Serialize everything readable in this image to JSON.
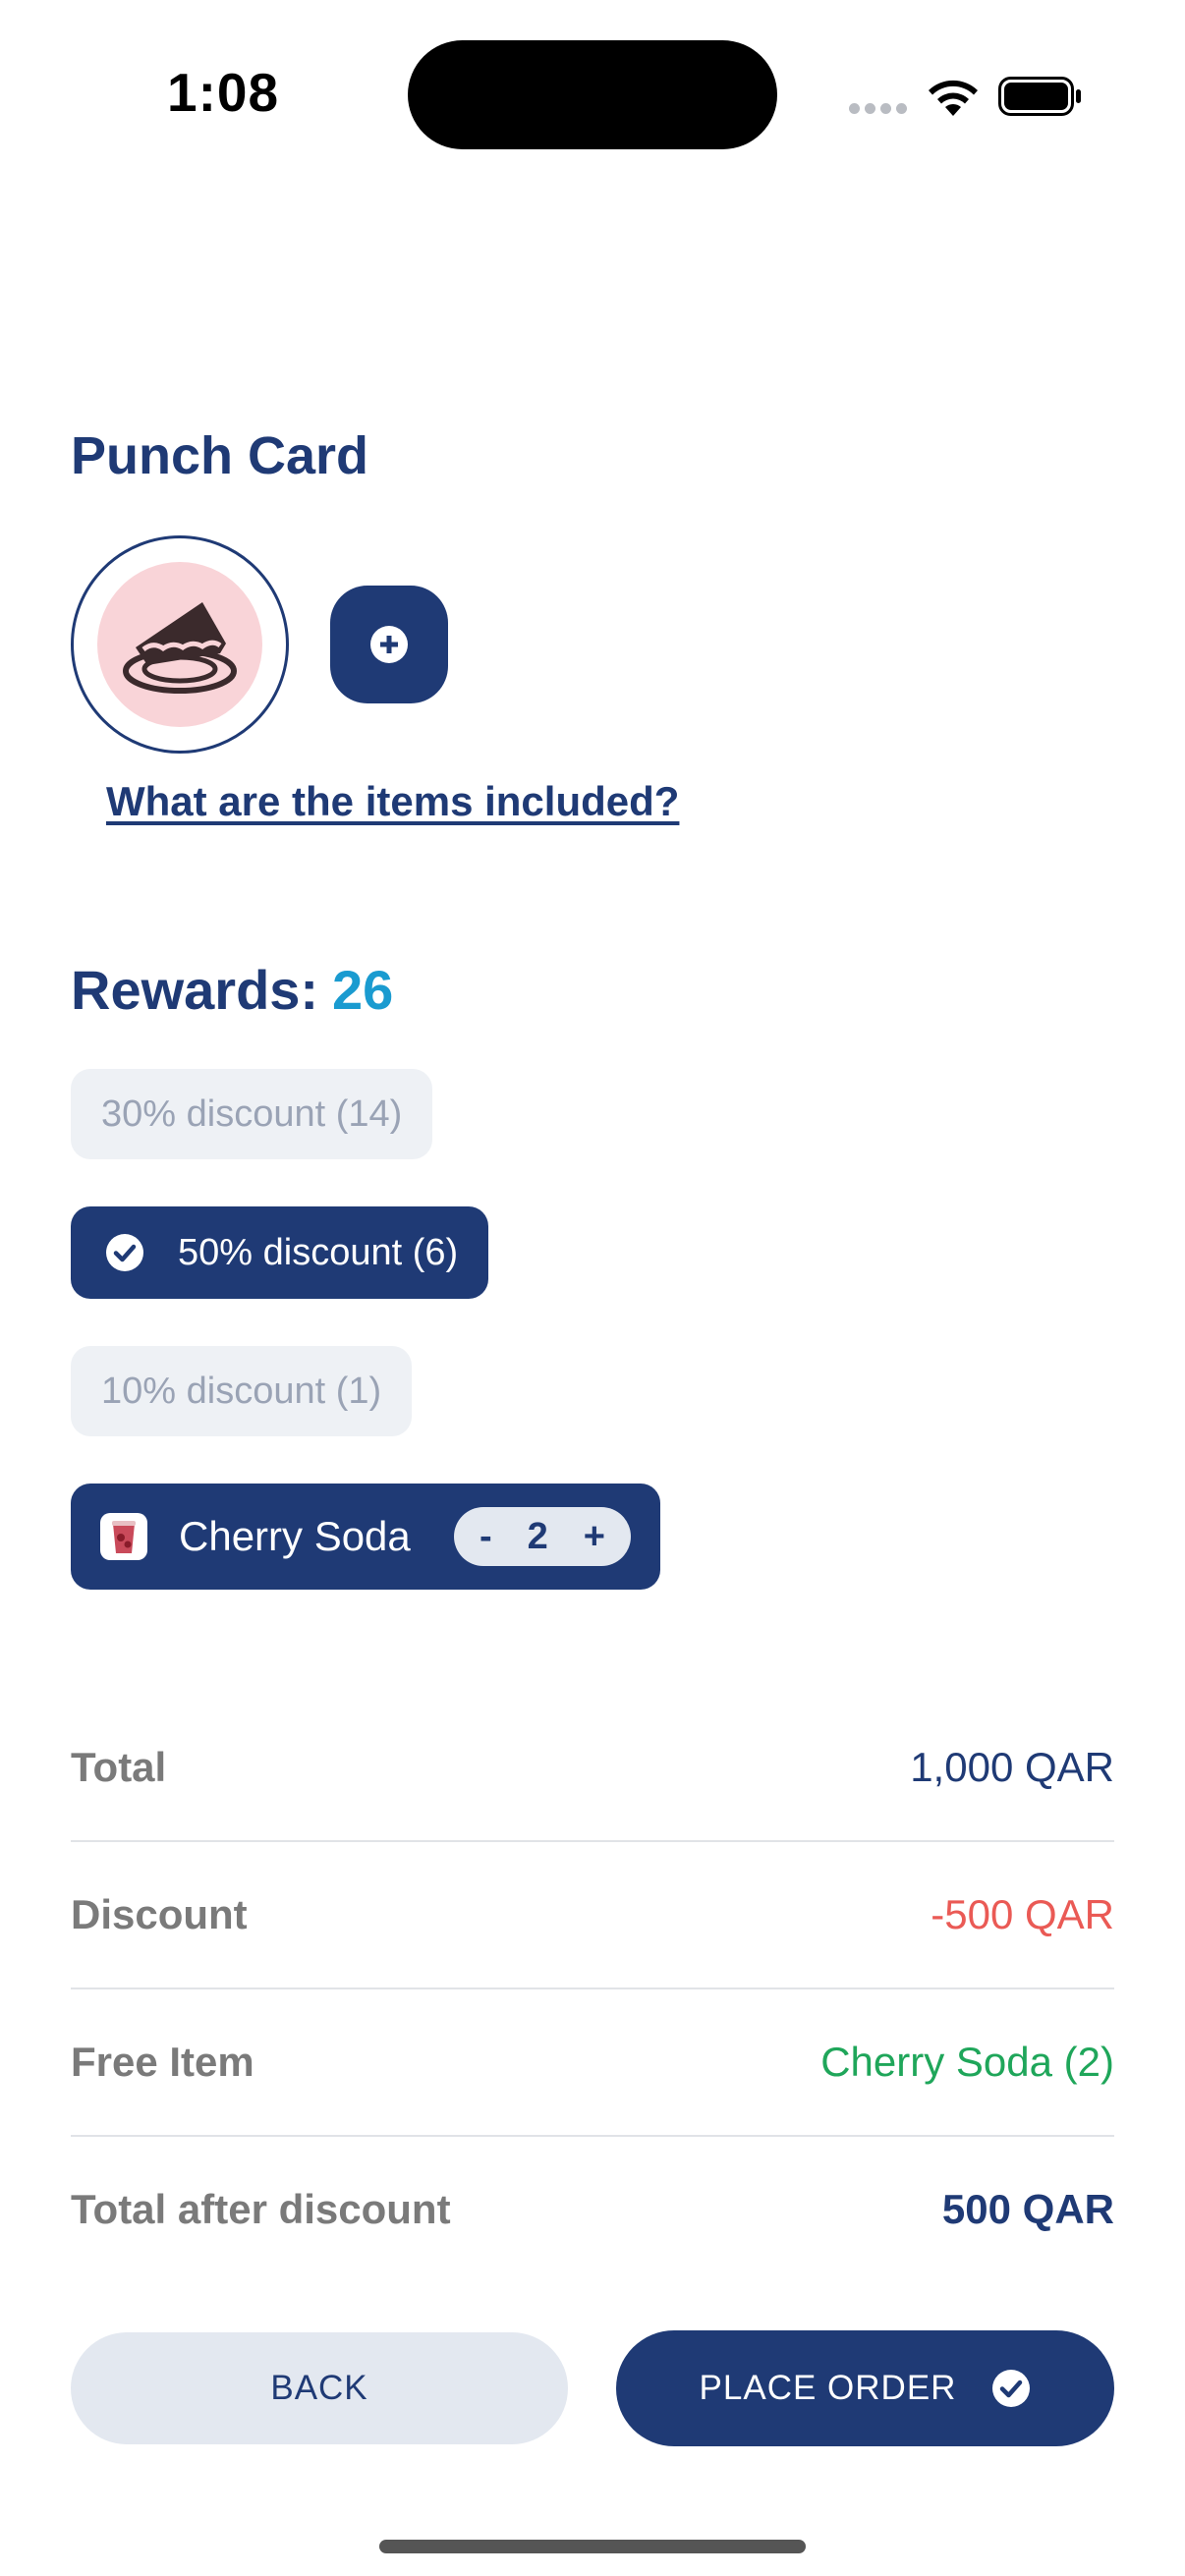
{
  "status_bar": {
    "time": "1:08"
  },
  "header": {
    "title": "Punch Card"
  },
  "punch_card": {
    "items_link": "What are the items included?"
  },
  "rewards": {
    "label": "Rewards:",
    "count": "26",
    "options": [
      {
        "label": "30% discount (14)",
        "selected": false
      },
      {
        "label": "50% discount (6)",
        "selected": true
      },
      {
        "label": "10% discount (1)",
        "selected": false
      }
    ],
    "free_item": {
      "name": "Cherry Soda",
      "quantity": "2",
      "minus": "-",
      "plus": "+"
    }
  },
  "summary": {
    "total_label": "Total",
    "total_value": "1,000 QAR",
    "discount_label": "Discount",
    "discount_value": "-500 QAR",
    "free_item_label": "Free Item",
    "free_item_value": "Cherry Soda (2)",
    "after_label": "Total after discount",
    "after_value": "500 QAR"
  },
  "actions": {
    "back": "BACK",
    "place_order": "PLACE ORDER"
  },
  "colors": {
    "primary": "#1f3a75",
    "accent": "#1a9bd0",
    "discount": "#ea5a55",
    "free": "#1fa65a"
  }
}
